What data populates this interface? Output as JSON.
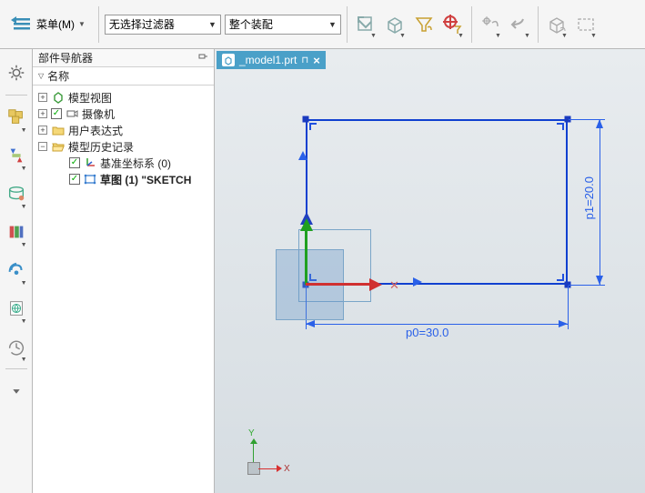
{
  "toolbar": {
    "menu_label": "菜单(M)",
    "filter_value": "无选择过滤器",
    "scope_value": "整个装配"
  },
  "navigator": {
    "title": "部件导航器",
    "column_name": "名称",
    "items": [
      {
        "label": "模型视图",
        "checked": null,
        "bold": false
      },
      {
        "label": "摄像机",
        "checked": true,
        "bold": false
      },
      {
        "label": "用户表达式",
        "checked": null,
        "bold": false
      },
      {
        "label": "模型历史记录",
        "checked": null,
        "bold": false
      },
      {
        "label": "基准坐标系 (0)",
        "checked": true,
        "bold": false
      },
      {
        "label": "草图 (1) \"SKETCH",
        "checked": true,
        "bold": true
      }
    ]
  },
  "tab": {
    "filename": "_model1.prt"
  },
  "sketch": {
    "dim_p0": "p0=30.0",
    "dim_p1": "p1=20.0"
  },
  "triad": {
    "x": "X",
    "y": "Y"
  }
}
